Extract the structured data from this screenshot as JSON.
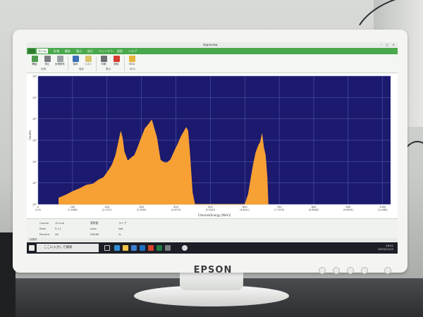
{
  "monitor": {
    "brand": "EPSON"
  },
  "window": {
    "title": "dsproview"
  },
  "tabs": [
    {
      "label": "ホーム"
    },
    {
      "label": "計測"
    },
    {
      "label": "解析"
    },
    {
      "label": "表示"
    },
    {
      "label": "校正"
    },
    {
      "label": "ウィンドウ"
    },
    {
      "label": "設定"
    },
    {
      "label": "ヘルプ"
    }
  ],
  "ribbon": {
    "buttons": [
      {
        "label": "開始",
        "icon": "play-icon"
      },
      {
        "label": "停止",
        "icon": "stop-icon"
      },
      {
        "label": "計測条件",
        "icon": "settings-icon"
      },
      {
        "label": "保存",
        "icon": "save-icon"
      },
      {
        "label": "リスト",
        "icon": "list-icon"
      },
      {
        "label": "印刷",
        "icon": "print-icon"
      },
      {
        "label": "削除",
        "icon": "delete-icon"
      },
      {
        "label": "MCA",
        "icon": "mca-icon"
      }
    ],
    "groups": [
      "計測",
      "保存",
      "表示",
      "MCA"
    ]
  },
  "chart_data": {
    "type": "area",
    "xlabel": "Channel(Energy [MeV])",
    "ylabel": "Counts",
    "y_scale": "log",
    "x_ticks": [
      {
        "value": 0,
        "label": "0",
        "sub": "(0.0)"
      },
      {
        "value": 100,
        "label": "100",
        "sub": "(1.1068)"
      },
      {
        "value": 200,
        "label": "200",
        "sub": "(2.2137)"
      },
      {
        "value": 300,
        "label": "300",
        "sub": "(3.3205)"
      },
      {
        "value": 400,
        "label": "400",
        "sub": "(4.4274)"
      },
      {
        "value": 500,
        "label": "500",
        "sub": "(5.5342)"
      },
      {
        "value": 600,
        "label": "600",
        "sub": "(6.6411)"
      },
      {
        "value": 700,
        "label": "700",
        "sub": "(7.7479)"
      },
      {
        "value": 800,
        "label": "800",
        "sub": "(8.8548)"
      },
      {
        "value": 900,
        "label": "900",
        "sub": "(9.9616)"
      },
      {
        "value": 1000,
        "label": "1000",
        "sub": "(11.068)"
      }
    ],
    "y_ticks": [
      "10⁰",
      "10¹",
      "10²",
      "10³",
      "10⁴",
      "10⁵",
      "10⁶"
    ],
    "xlim": [
      0,
      1023
    ],
    "ylim": [
      1,
      1000000
    ],
    "grid": true,
    "series": [
      {
        "color": "#f7a034",
        "x": [
          60,
          80,
          100,
          120,
          140,
          160,
          175,
          190,
          205,
          215,
          225,
          235,
          240,
          245,
          250,
          260,
          270,
          280,
          290,
          300,
          310,
          320,
          330,
          345,
          355,
          365,
          375,
          385,
          395,
          405,
          415,
          425,
          430,
          435,
          440,
          448,
          455,
          600,
          610,
          618,
          625,
          632,
          640,
          645,
          650,
          655,
          660,
          665,
          668
        ],
        "y": [
          2,
          3,
          4,
          6,
          8,
          10,
          14,
          20,
          40,
          80,
          200,
          1200,
          2600,
          1400,
          300,
          120,
          150,
          220,
          500,
          1500,
          3500,
          6000,
          9000,
          1400,
          120,
          100,
          90,
          140,
          300,
          700,
          1500,
          3200,
          4000,
          3000,
          300,
          4,
          0,
          0,
          3,
          20,
          80,
          300,
          600,
          900,
          2000,
          500,
          200,
          20,
          0
        ]
      }
    ]
  },
  "info_panel": {
    "row1": [
      "Counts",
      "10 min",
      "実時間",
      "ライブ"
    ],
    "row2": [
      "Peak",
      "5.11",
      "Area",
      "Net"
    ],
    "row3": [
      "Percent",
      "28",
      "FWHM",
      "%"
    ]
  },
  "statusbar": {
    "text": "計測中"
  },
  "taskbar": {
    "search_placeholder": "ここに入力して検索",
    "time": "16:51",
    "date": "2023/11/22"
  }
}
